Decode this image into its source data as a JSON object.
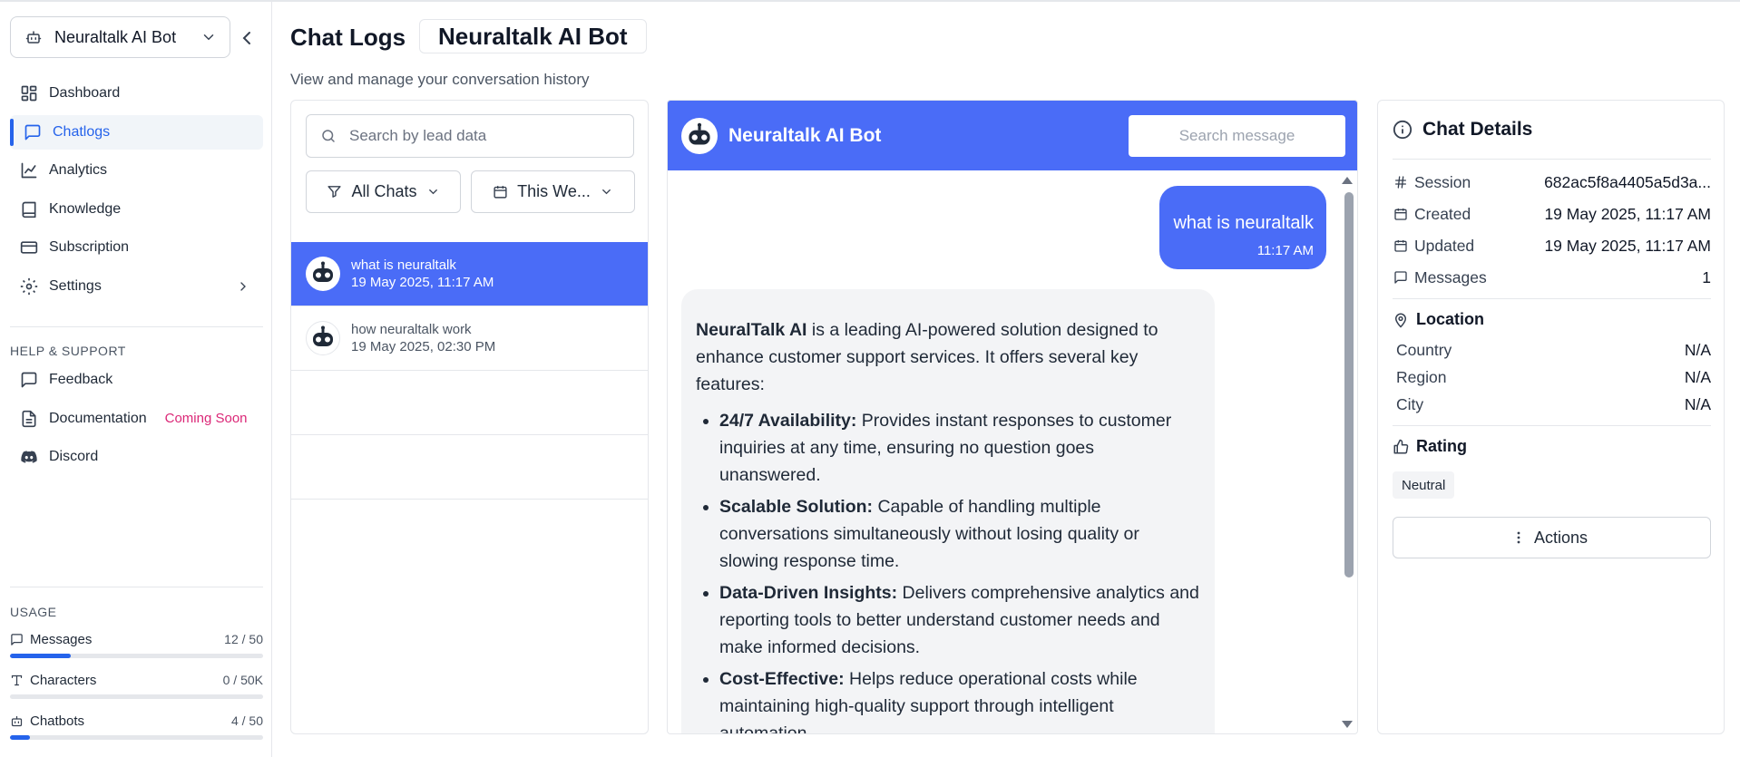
{
  "sidebar": {
    "bot_select": "Neuraltalk AI Bot",
    "nav": [
      {
        "label": "Dashboard",
        "icon": "dashboard-icon"
      },
      {
        "label": "Chatlogs",
        "icon": "chat-icon",
        "active": true
      },
      {
        "label": "Analytics",
        "icon": "chart-line-icon"
      },
      {
        "label": "Knowledge",
        "icon": "book-icon"
      },
      {
        "label": "Subscription",
        "icon": "credit-card-icon"
      },
      {
        "label": "Settings",
        "icon": "gear-icon"
      }
    ],
    "help_title": "HELP & SUPPORT",
    "help": [
      {
        "label": "Feedback",
        "icon": "message-icon"
      },
      {
        "label": "Documentation",
        "icon": "document-icon",
        "badge": "Coming Soon"
      },
      {
        "label": "Discord",
        "icon": "discord-icon"
      }
    ],
    "usage_title": "USAGE",
    "usage": [
      {
        "label": "Messages",
        "value": "12 / 50",
        "fraction": 0.24,
        "icon": "message-icon"
      },
      {
        "label": "Characters",
        "value": "0 / 50K",
        "fraction": 0.0,
        "icon": "type-icon"
      },
      {
        "label": "Chatbots",
        "value": "4 / 50",
        "fraction": 0.08,
        "icon": "bot-icon"
      }
    ]
  },
  "header": {
    "title": "Chat Logs",
    "bot_name": "Neuraltalk AI Bot",
    "subtitle": "View and manage your conversation history"
  },
  "chat_list": {
    "search_placeholder": "Search by lead data",
    "filter_chats": "All Chats",
    "filter_date": "This We...",
    "items": [
      {
        "title": "what is neuraltalk",
        "date": "19 May 2025, 11:17 AM",
        "active": true
      },
      {
        "title": "how neuraltalk work",
        "date": "19 May 2025, 02:30 PM",
        "active": false
      }
    ]
  },
  "conversation": {
    "bot_name": "Neuraltalk AI Bot",
    "search_placeholder": "Search message",
    "user_message": "what is neuraltalk",
    "user_time": "11:17 AM",
    "bot_intro_bold": "NeuralTalk AI",
    "bot_intro_rest": " is a leading AI-powered solution designed to enhance customer support services. It offers several key features:",
    "features": [
      {
        "title": "24/7 Availability:",
        "text": " Provides instant responses to customer inquiries at any time, ensuring no question goes unanswered."
      },
      {
        "title": "Scalable Solution:",
        "text": " Capable of handling multiple conversations simultaneously without losing quality or slowing response time."
      },
      {
        "title": "Data-Driven Insights:",
        "text": " Delivers comprehensive analytics and reporting tools to better understand customer needs and make informed decisions."
      },
      {
        "title": "Cost-Effective:",
        "text": " Helps reduce operational costs while maintaining high-quality support through intelligent automation."
      }
    ]
  },
  "details": {
    "title": "Chat Details",
    "session_label": "Session",
    "session_value": "682ac5f8a4405a5d3a...",
    "created_label": "Created",
    "created_value": "19 May 2025, 11:17 AM",
    "updated_label": "Updated",
    "updated_value": "19 May 2025, 11:17 AM",
    "messages_label": "Messages",
    "messages_value": "1",
    "location_title": "Location",
    "country_label": "Country",
    "country_value": "N/A",
    "region_label": "Region",
    "region_value": "N/A",
    "city_label": "City",
    "city_value": "N/A",
    "rating_title": "Rating",
    "rating_value": "Neutral",
    "actions_label": "Actions"
  },
  "colors": {
    "accent": "#4a6cf7",
    "active_nav": "#2563eb",
    "coming_soon": "#db2777"
  }
}
